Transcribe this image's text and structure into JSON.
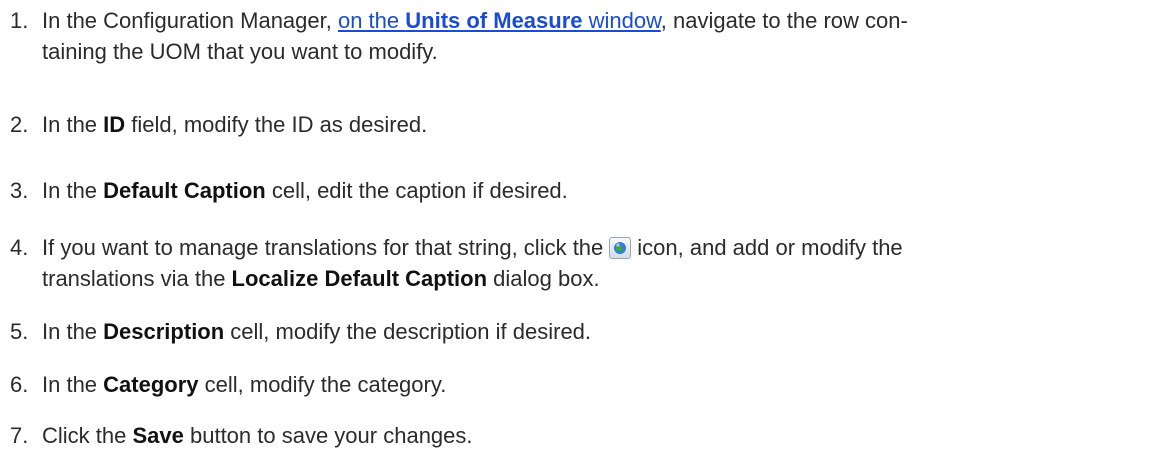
{
  "steps": [
    {
      "number": "1.",
      "pre": "In the Configuration Manager, ",
      "link_pre": "on the ",
      "link_bold": "Units of Measure",
      "link_post": " window",
      "post_line1": ", navigate to the row con-",
      "line2": "taining the UOM that you want to modify."
    },
    {
      "number": "2.",
      "pre": "In the ",
      "bold": "ID",
      "post": " field, modify the ID as desired."
    },
    {
      "number": "3.",
      "pre": "In the ",
      "bold": "Default Caption",
      "post": " cell, edit the caption if desired."
    },
    {
      "number": "4.",
      "pre": "If you want to manage translations for that string, click the",
      "icon": "localize-globe-icon",
      "post": "icon, and add or modify the",
      "line2_pre": "translations via the ",
      "line2_bold": "Localize Default Caption",
      "line2_post": " dialog box."
    },
    {
      "number": "5.",
      "pre": "In the ",
      "bold": "Description",
      "post": " cell, modify the description if desired."
    },
    {
      "number": "6.",
      "pre": "In the ",
      "bold": "Category",
      "post": " cell, modify the category."
    },
    {
      "number": "7.",
      "pre": "Click the ",
      "bold": "Save",
      "post": " button to save your changes."
    }
  ],
  "colors": {
    "link": "#1a4bd6",
    "text": "#2b2b2b"
  }
}
